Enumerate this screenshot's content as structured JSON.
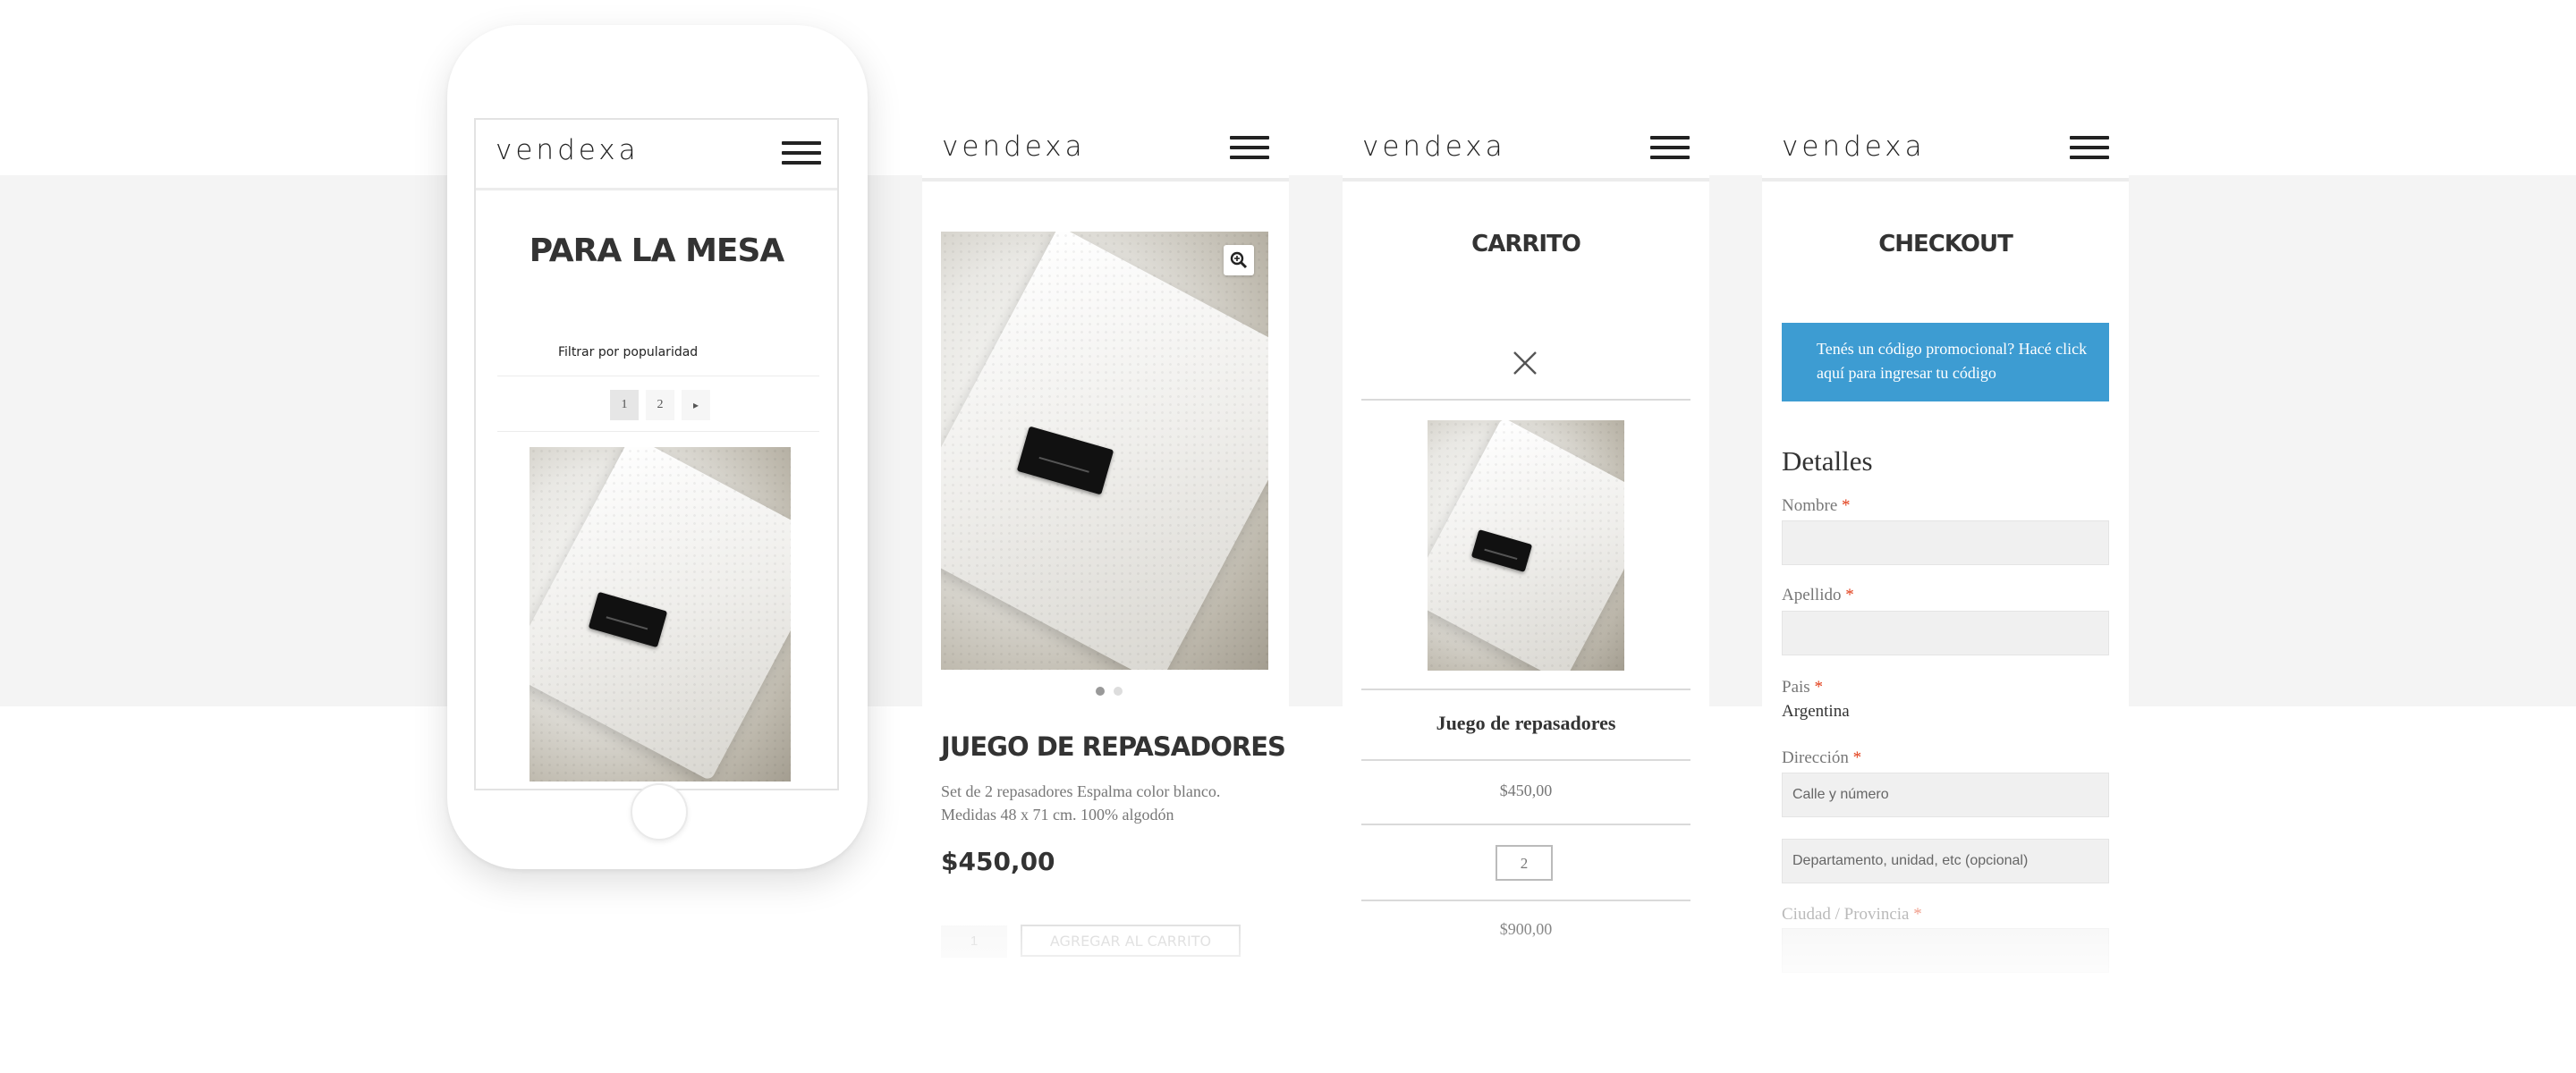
{
  "brand": {
    "logo": "vendexa"
  },
  "colors": {
    "band": "#f4f4f4",
    "info_box": "#3d9cd2",
    "required": "#e2401c"
  },
  "phone": {
    "category_title": "PARA LA MESA",
    "sort_label": "Filtrar por popularidad",
    "pagination": [
      "1",
      "2",
      "▸"
    ]
  },
  "product": {
    "title": "JUEGO DE REPASADORES",
    "description": "Set de 2 repasadores Espalma color blanco. Medidas 48 x 71 cm. 100% algodón",
    "price": "$450,00",
    "qty": "1",
    "add_to_cart": "AGREGAR AL CARRITO",
    "zoom_icon": "zoom-in-icon",
    "gallery_dots": 2
  },
  "cart": {
    "title": "CARRITO",
    "remove_icon": "close-icon",
    "item_name": "Juego de repasadores",
    "price": "$450,00",
    "qty": "2",
    "subtotal": "$900,00"
  },
  "checkout": {
    "title": "CHECKOUT",
    "coupon_notice": "Tenés un código promocional? Hacé click aquí para ingresar tu código",
    "section_title": "Detalles",
    "fields": {
      "nombre": "Nombre",
      "apellido": "Apellido",
      "pais": "Pais",
      "pais_value": "Argentina",
      "direccion": "Dirección",
      "direccion_placeholder": "Calle y número",
      "direccion2_placeholder": "Departamento, unidad, etc (opcional)",
      "ciudad": "Ciudad / Provincia"
    },
    "required_mark": "*"
  }
}
